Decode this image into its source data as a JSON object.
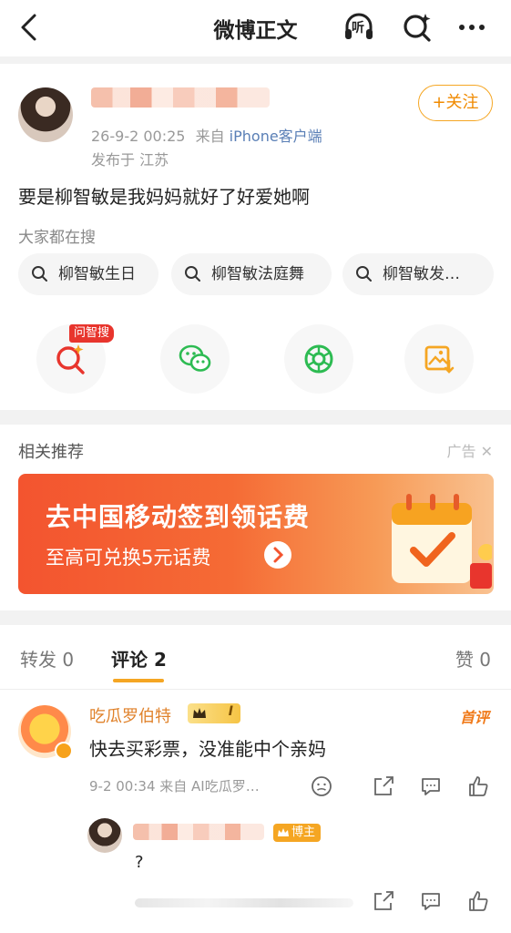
{
  "nav": {
    "title": "微博正文",
    "listen_label": "听"
  },
  "post": {
    "timestamp": "26-9-2 00:25",
    "source_prefix": "来自",
    "source": "iPhone客户端",
    "location": "发布于 江苏",
    "follow_label": "+关注",
    "text": "要是柳智敏是我妈妈就好了好爱她啊",
    "search_hint": "大家都在搜",
    "chips": [
      "柳智敏生日",
      "柳智敏法庭舞",
      "柳智敏发…"
    ],
    "ask_badge": "问智搜",
    "actions": [
      "ai-search-icon",
      "wechat-icon",
      "moments-icon",
      "save-image-icon"
    ]
  },
  "recommend": {
    "title": "相关推荐",
    "ad_label": "广告",
    "banner_main": "去中国移动签到领话费",
    "banner_sub": "至高可兑换5元话费"
  },
  "comments": {
    "tabs": [
      {
        "label": "转发 0"
      },
      {
        "label": "评论 2"
      },
      {
        "label": "赞 0"
      }
    ],
    "items": [
      {
        "name": "吃瓜罗伯特",
        "level": "I",
        "tag": "首评",
        "text": "快去买彩票，没准能中个亲妈",
        "meta": "9-2 00:34  来自 AI吃瓜罗…"
      },
      {
        "author_badge": "博主",
        "text": "?"
      }
    ]
  },
  "colors": {
    "accent": "#f5a623",
    "link": "#5a7fb6",
    "banner": "#f3542f"
  }
}
